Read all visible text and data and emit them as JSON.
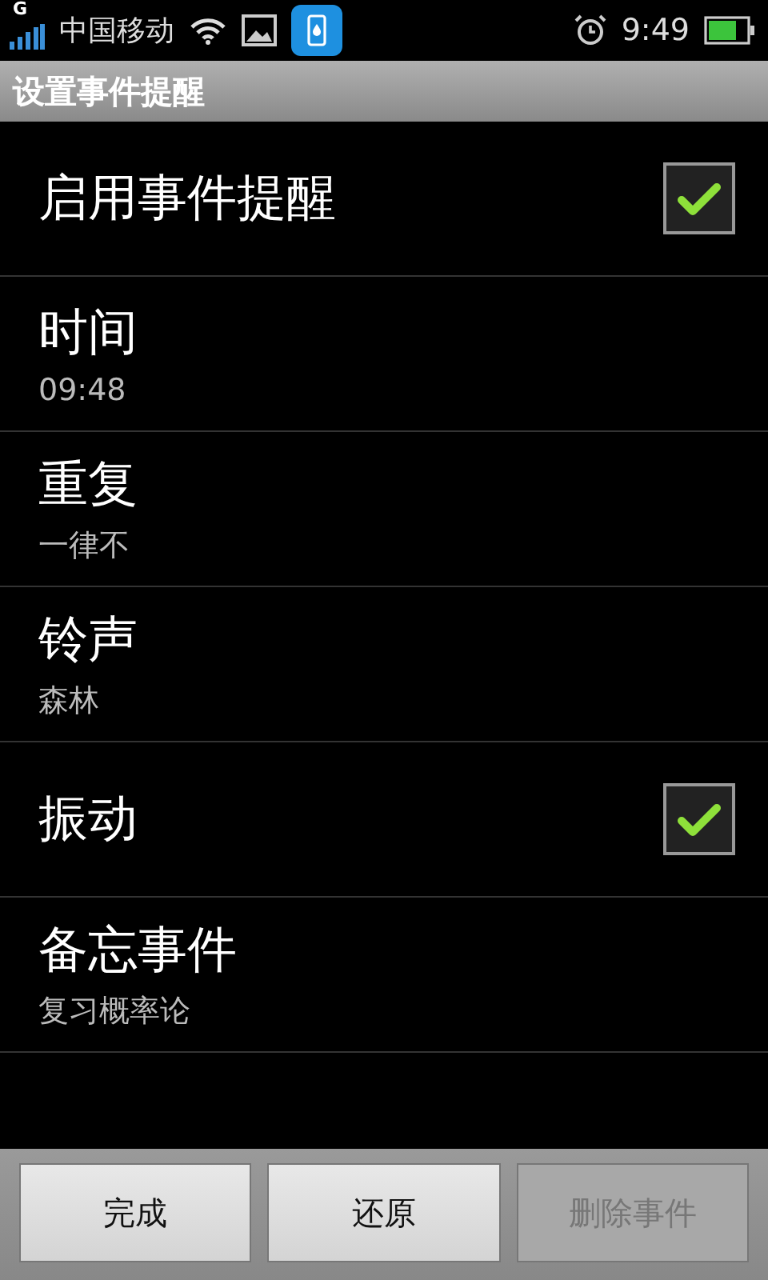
{
  "status_bar": {
    "network": "G",
    "carrier": "中国移动",
    "time": "9:49"
  },
  "title": "设置事件提醒",
  "settings": [
    {
      "kind": "checkbox",
      "label": "启用事件提醒",
      "checked": true
    },
    {
      "kind": "value",
      "label": "时间",
      "value": "09:48"
    },
    {
      "kind": "value",
      "label": "重复",
      "value": "一律不"
    },
    {
      "kind": "value",
      "label": "铃声",
      "value": "森林"
    },
    {
      "kind": "checkbox",
      "label": "振动",
      "checked": true
    },
    {
      "kind": "value",
      "label": "备忘事件",
      "value": "复习概率论"
    }
  ],
  "buttons": [
    {
      "label": "完成",
      "disabled": false
    },
    {
      "label": "还原",
      "disabled": false
    },
    {
      "label": "删除事件",
      "disabled": true
    }
  ]
}
